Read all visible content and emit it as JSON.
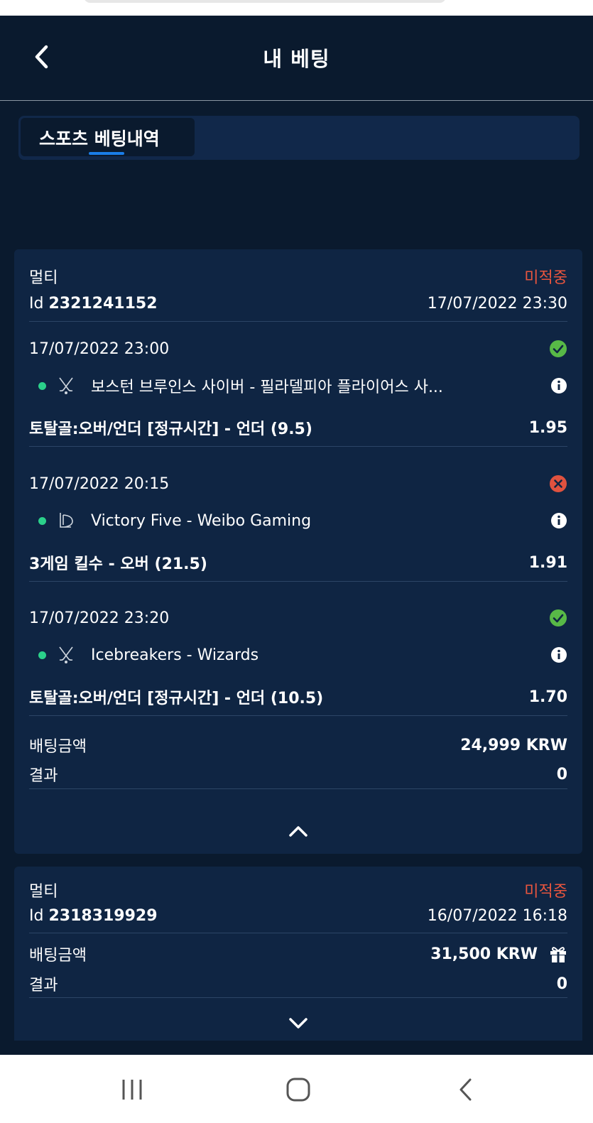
{
  "header": {
    "title": "내 베팅"
  },
  "tabs": [
    {
      "label": "스포츠 베팅내역",
      "active": true
    }
  ],
  "colors": {
    "background": "#0a1a2e",
    "card": "#0f2543",
    "pending": "#e8553e",
    "win": "#58b947",
    "loss": "#e0523f",
    "accent": "#1a7de8",
    "live_dot": "#2bd08a"
  },
  "bets": [
    {
      "type": "멀티",
      "status": "미적중",
      "id_label": "Id",
      "id": "2321241152",
      "placed_at": "17/07/2022 23:30",
      "selections": [
        {
          "datetime": "17/07/2022 23:00",
          "result_icon": "check-circle-icon",
          "sport_icon": "hockey-sticks-icon",
          "match": "보스턴 브루인스 사이버 - 필라델피아 플라이어스 사...",
          "market": "토탈골:오버/언더 [정규시간] - 언더 (9.5)",
          "odds": "1.95"
        },
        {
          "datetime": "17/07/2022 20:15",
          "result_icon": "x-circle-icon",
          "sport_icon": "esports-lol-icon",
          "match": "Victory Five - Weibo Gaming",
          "market": "3게임 킬수 - 오버 (21.5)",
          "odds": "1.91"
        },
        {
          "datetime": "17/07/2022 23:20",
          "result_icon": "check-circle-icon",
          "sport_icon": "hockey-sticks-icon",
          "match": "Icebreakers - Wizards",
          "market": "토탈골:오버/언더 [정규시간] - 언더 (10.5)",
          "odds": "1.70"
        }
      ],
      "stake_label": "배팅금액",
      "stake": "24,999 KRW",
      "result_label": "결과",
      "result": "0",
      "expanded": true
    },
    {
      "type": "멀티",
      "status": "미적중",
      "id_label": "Id",
      "id": "2318319929",
      "placed_at": "16/07/2022 16:18",
      "stake_label": "배팅금액",
      "stake": "31,500 KRW",
      "stake_icon": "gift-icon",
      "result_label": "결과",
      "result": "0",
      "expanded": false
    }
  ],
  "system_nav": {
    "items": [
      "recent-apps-icon",
      "home-icon",
      "back-icon"
    ]
  }
}
